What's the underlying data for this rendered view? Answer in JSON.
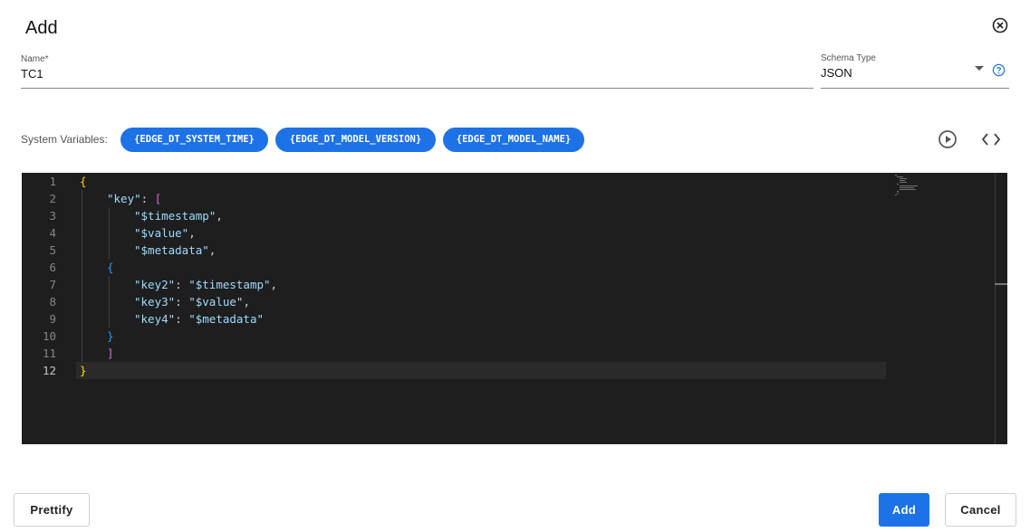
{
  "dialog": {
    "title": "Add"
  },
  "name_field": {
    "label": "Name*",
    "value": "TC1"
  },
  "schema_field": {
    "label": "Schema Type",
    "value": "JSON"
  },
  "system_variables": {
    "label": "System Variables:",
    "chips": [
      "{EDGE_DT_SYSTEM_TIME}",
      "{EDGE_DT_MODEL_VERSION}",
      "{EDGE_DT_MODEL_NAME}"
    ]
  },
  "editor": {
    "line_numbers": [
      "1",
      "2",
      "3",
      "4",
      "5",
      "6",
      "7",
      "8",
      "9",
      "10",
      "11",
      "12"
    ],
    "active_line": 12,
    "code": {
      "l1": "{",
      "l2_key": "\"key\"",
      "l2_colon": ": ",
      "l2_bracket": "[",
      "l3": "\"$timestamp\"",
      "l3_comma": ",",
      "l4": "\"$value\"",
      "l4_comma": ",",
      "l5": "\"$metadata\"",
      "l5_comma": ",",
      "l6": "{",
      "l7_key": "\"key2\"",
      "l7_colon": ": ",
      "l7_val": "\"$timestamp\"",
      "l7_comma": ",",
      "l8_key": "\"key3\"",
      "l8_colon": ": ",
      "l8_val": "\"$value\"",
      "l8_comma": ",",
      "l9_key": "\"key4\"",
      "l9_colon": ": ",
      "l9_val": "\"$metadata\"",
      "l10": "}",
      "l11": "]",
      "l12": "}"
    }
  },
  "buttons": {
    "prettify": "Prettify",
    "add": "Add",
    "cancel": "Cancel"
  },
  "icons": {
    "close": "close-circle-icon",
    "dropdown": "caret-down-icon",
    "help": "help-circle-icon",
    "run": "play-circle-icon",
    "code": "code-brackets-icon"
  },
  "colors": {
    "accent": "#1d72e8",
    "editor_bg": "#1e1e1e"
  }
}
